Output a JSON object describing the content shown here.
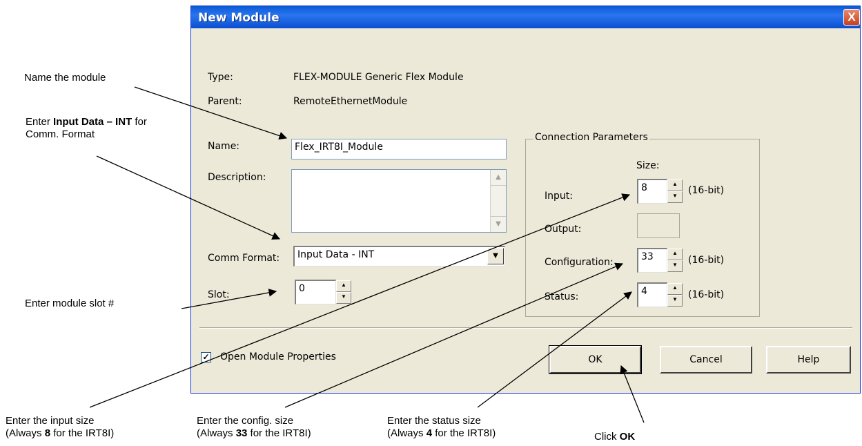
{
  "dialog": {
    "title": "New Module",
    "close_symbol": "X",
    "type_label": "Type:",
    "type_value": "FLEX-MODULE Generic Flex Module",
    "parent_label": "Parent:",
    "parent_value": "RemoteEthernetModule",
    "name_label": "Name:",
    "name_value": "Flex_IRT8I_Module",
    "description_label": "Description:",
    "description_value": "",
    "comm_format_label": "Comm Format:",
    "comm_format_value": "Input Data - INT",
    "slot_label": "Slot:",
    "slot_value": "0",
    "connection": {
      "title": "Connection Parameters",
      "size_header": "Size:",
      "input_label": "Input:",
      "input_value": "8",
      "input_unit": "(16-bit)",
      "output_label": "Output:",
      "output_value": "",
      "configuration_label": "Configuration:",
      "configuration_value": "33",
      "configuration_unit": "(16-bit)",
      "status_label": "Status:",
      "status_value": "4",
      "status_unit": "(16-bit)"
    },
    "open_properties_label": "Open Module Properties",
    "open_properties_checked": true,
    "ok_label": "OK",
    "cancel_label": "Cancel",
    "help_label": "Help"
  },
  "annotations": {
    "name": "Name the module",
    "comm_prefix": "Enter ",
    "comm_bold": "Input Data – INT",
    "comm_suffix": " for",
    "comm_line2": "Comm. Format",
    "slot": "Enter module  slot #",
    "input_line1": "Enter the input size",
    "input_l2_prefix": "(Always ",
    "input_l2_bold": "8",
    "input_l2_suffix": " for the IRT8I)",
    "config_line1": "Enter the config. size",
    "config_l2_prefix": "(Always ",
    "config_l2_bold": "33",
    "config_l2_suffix": " for the IRT8I)",
    "status_line1": "Enter the status size",
    "status_l2_prefix": "(Always ",
    "status_l2_bold": "4",
    "status_l2_suffix": " for the IRT8I)",
    "ok_prefix": "Click ",
    "ok_bold": "OK"
  }
}
